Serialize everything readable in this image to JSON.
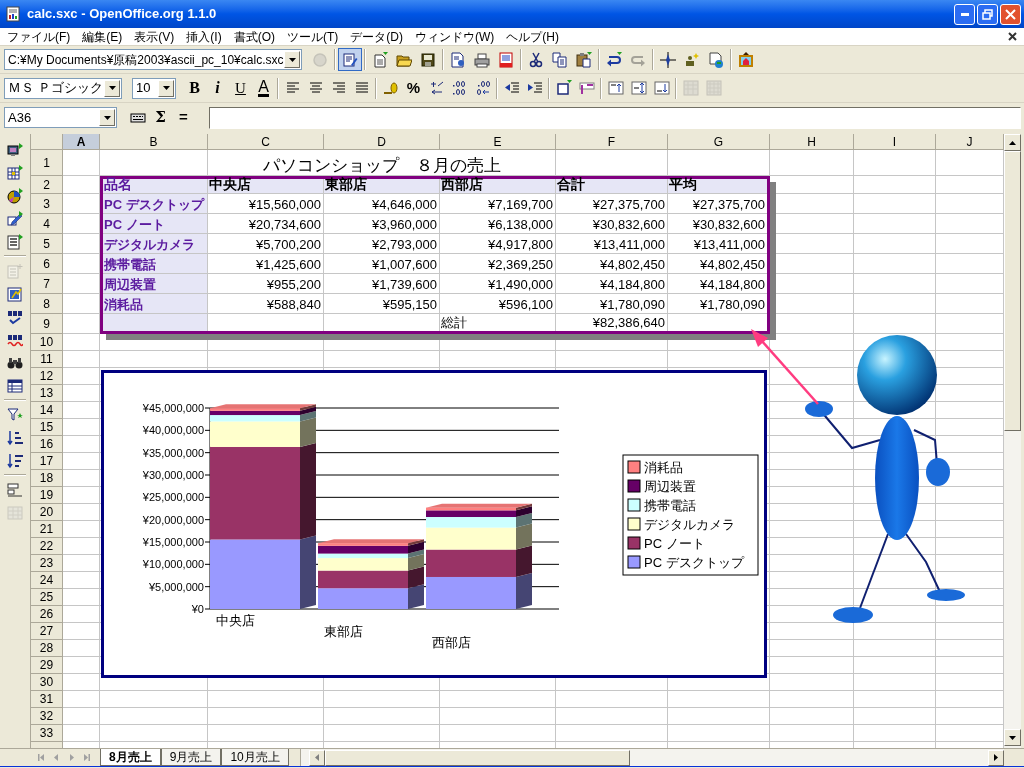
{
  "window": {
    "title": "calc.sxc - OpenOffice.org 1.1.0"
  },
  "menu": [
    "ファイル(F)",
    "編集(E)",
    "表示(V)",
    "挿入(I)",
    "書式(O)",
    "ツール(T)",
    "データ(D)",
    "ウィンドウ(W)",
    "ヘルプ(H)"
  ],
  "function_bar": {
    "path_field": {
      "value": "C:¥My Documents¥原稿2003¥ascii_pc_10¥calc.sxc"
    },
    "groups": [
      [
        {
          "disabled": true,
          "pressed": false
        }
      ],
      [
        {
          "disabled": false,
          "pressed": true
        }
      ],
      [
        {
          "disabled": false,
          "pressed": false
        },
        {
          "disabled": false,
          "pressed": false
        },
        {
          "disabled": false,
          "pressed": false
        }
      ],
      [
        {
          "disabled": false,
          "pressed": false
        },
        {
          "disabled": false,
          "pressed": false
        },
        {
          "disabled": false,
          "pressed": false
        }
      ],
      [
        {
          "disabled": false,
          "pressed": false
        },
        {
          "disabled": false,
          "pressed": false
        },
        {
          "disabled": false,
          "pressed": false
        }
      ],
      [
        {
          "disabled": false,
          "pressed": false
        },
        {
          "disabled": true,
          "pressed": false
        }
      ],
      [
        {
          "disabled": false,
          "pressed": false
        },
        {
          "disabled": false,
          "pressed": false
        },
        {
          "disabled": false,
          "pressed": false
        }
      ],
      [
        {
          "disabled": false,
          "pressed": false
        }
      ]
    ]
  },
  "object_bar": {
    "font_name": {
      "value": "ＭＳ Ｐゴシック"
    },
    "font_size": {
      "value": "10"
    },
    "groups": [
      [
        {
          "kind": "text",
          "label": "B",
          "disabled": false
        },
        {
          "kind": "text",
          "label": "i",
          "disabled": false
        },
        {
          "kind": "text",
          "label": "U",
          "disabled": false
        },
        {
          "kind": "text",
          "label": "A",
          "disabled": false
        }
      ],
      [
        {
          "kind": "icon",
          "disabled": false
        },
        {
          "kind": "icon",
          "disabled": false
        },
        {
          "kind": "icon",
          "disabled": false
        },
        {
          "kind": "icon",
          "disabled": false
        }
      ],
      [
        {
          "kind": "icon",
          "disabled": false
        },
        {
          "kind": "text",
          "label": "%",
          "disabled": false
        },
        {
          "kind": "icon",
          "disabled": false
        },
        {
          "kind": "icon",
          "disabled": false
        },
        {
          "kind": "icon",
          "disabled": false
        }
      ],
      [
        {
          "kind": "icon",
          "disabled": false
        },
        {
          "kind": "icon",
          "disabled": false
        }
      ],
      [
        {
          "kind": "icon",
          "disabled": false
        },
        {
          "kind": "icon",
          "disabled": false
        }
      ],
      [
        {
          "kind": "icon",
          "disabled": false
        },
        {
          "kind": "icon",
          "disabled": false
        },
        {
          "kind": "icon",
          "disabled": false
        }
      ],
      [
        {
          "kind": "icon",
          "disabled": true
        },
        {
          "kind": "icon",
          "disabled": true
        }
      ]
    ]
  },
  "formula_bar": {
    "name_box": {
      "value": "A36"
    },
    "buttons": [
      {
        "kind": "icon"
      },
      {
        "kind": "text",
        "label": "Σ"
      },
      {
        "kind": "text",
        "label": "="
      }
    ]
  },
  "side_toolbar": {
    "groups": [
      [
        {
          "disabled": false
        },
        {
          "disabled": false
        },
        {
          "disabled": false
        },
        {
          "disabled": false
        },
        {
          "disabled": false
        }
      ],
      [
        {
          "disabled": true
        },
        {
          "disabled": false
        },
        {
          "disabled": false
        },
        {
          "disabled": false
        },
        {
          "disabled": false
        },
        {
          "disabled": false
        }
      ],
      [
        {
          "disabled": false
        },
        {
          "disabled": false
        },
        {
          "disabled": false
        }
      ],
      [
        {
          "disabled": false
        },
        {
          "disabled": true
        }
      ]
    ]
  },
  "sheet": {
    "columns": [
      {
        "label": "A",
        "selected": true
      },
      {
        "label": "B",
        "selected": false
      },
      {
        "label": "C",
        "selected": false
      },
      {
        "label": "D",
        "selected": false
      },
      {
        "label": "E",
        "selected": false
      },
      {
        "label": "F",
        "selected": false
      },
      {
        "label": "G",
        "selected": false
      },
      {
        "label": "H",
        "selected": false
      },
      {
        "label": "I",
        "selected": false
      },
      {
        "label": "J",
        "selected": false
      }
    ],
    "rows": [
      "1",
      "2",
      "3",
      "4",
      "5",
      "6",
      "7",
      "8",
      "9",
      "10",
      "11",
      "12",
      "13",
      "14",
      "15",
      "16",
      "17",
      "18",
      "19",
      "20",
      "21",
      "22",
      "23",
      "24",
      "25",
      "26",
      "27",
      "28",
      "29",
      "30",
      "31",
      "32",
      "33"
    ],
    "title": "パソコンショップ　８月の売上",
    "table": {
      "header": [
        "品名",
        "中央店",
        "東部店",
        "西部店",
        "合計",
        "平均"
      ],
      "rows": [
        {
          "name": "PC デスクトップ",
          "values": [
            "¥15,560,000",
            "¥4,646,000",
            "¥7,169,700",
            "¥27,375,700",
            "¥27,375,700"
          ]
        },
        {
          "name": "PC ノート",
          "values": [
            "¥20,734,600",
            "¥3,960,000",
            "¥6,138,000",
            "¥30,832,600",
            "¥30,832,600"
          ]
        },
        {
          "name": "デジタルカメラ",
          "values": [
            "¥5,700,200",
            "¥2,793,000",
            "¥4,917,800",
            "¥13,411,000",
            "¥13,411,000"
          ]
        },
        {
          "name": "携帯電話",
          "values": [
            "¥1,425,600",
            "¥1,007,600",
            "¥2,369,250",
            "¥4,802,450",
            "¥4,802,450"
          ]
        },
        {
          "name": "周辺装置",
          "values": [
            "¥955,200",
            "¥1,739,600",
            "¥1,490,000",
            "¥4,184,800",
            "¥4,184,800"
          ]
        },
        {
          "name": "消耗品",
          "values": [
            "¥588,840",
            "¥595,150",
            "¥596,100",
            "¥1,780,090",
            "¥1,780,090"
          ]
        }
      ],
      "total": {
        "label": "総計",
        "value": "¥82,386,640"
      }
    }
  },
  "chart": {
    "chart_data": {
      "type": "bar",
      "stacked": true,
      "grid": true,
      "legend": "right",
      "categories": [
        "中央店",
        "東部店",
        "西部店"
      ],
      "series": [
        {
          "name": "PC デスクトップ",
          "color": "#9999ff",
          "values": [
            15560000,
            4646000,
            7169700
          ]
        },
        {
          "name": "PC ノート",
          "color": "#993366",
          "values": [
            20734600,
            3960000,
            6138000
          ]
        },
        {
          "name": "デジタルカメラ",
          "color": "#ffffcc",
          "values": [
            5700200,
            2793000,
            4917800
          ]
        },
        {
          "name": "携帯電話",
          "color": "#ccffff",
          "values": [
            1425600,
            1007600,
            2369250
          ]
        },
        {
          "name": "周辺装置",
          "color": "#660066",
          "values": [
            955200,
            1739600,
            1490000
          ]
        },
        {
          "name": "消耗品",
          "color": "#ff8080",
          "values": [
            588840,
            595150,
            596100
          ]
        }
      ],
      "ylim": [
        0,
        45000000
      ],
      "yticks": [
        {
          "value": 0,
          "label": "¥0"
        },
        {
          "value": 5000000,
          "label": "¥5,000,000"
        },
        {
          "value": 10000000,
          "label": "¥10,000,000"
        },
        {
          "value": 15000000,
          "label": "¥15,000,000"
        },
        {
          "value": 20000000,
          "label": "¥20,000,000"
        },
        {
          "value": 25000000,
          "label": "¥25,000,000"
        },
        {
          "value": 30000000,
          "label": "¥30,000,000"
        },
        {
          "value": 35000000,
          "label": "¥35,000,000"
        },
        {
          "value": 40000000,
          "label": "¥40,000,000"
        },
        {
          "value": 45000000,
          "label": "¥45,000,000"
        }
      ]
    }
  },
  "sheet_tabs": [
    {
      "label": "8月売上",
      "selected": true
    },
    {
      "label": "9月売上",
      "selected": false
    },
    {
      "label": "10月売上",
      "selected": false
    }
  ]
}
